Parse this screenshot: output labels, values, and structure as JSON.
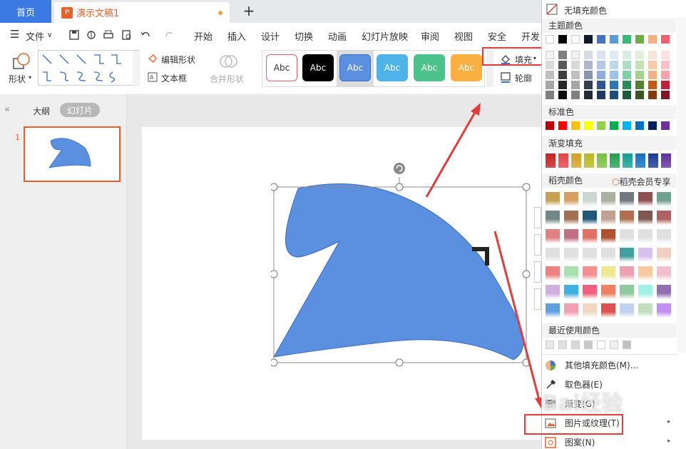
{
  "titlebar": {
    "home": "首页",
    "doc_title": "演示文稿1",
    "new_tab": "+"
  },
  "menubar": {
    "file": "文件",
    "items": [
      "开始",
      "插入",
      "设计",
      "切换",
      "动画",
      "幻灯片放映",
      "审阅",
      "视图",
      "安全",
      "开发"
    ]
  },
  "ribbon": {
    "shapes_label": "形状",
    "edit_shape": "编辑形状",
    "textbox": "文本框",
    "merge_shapes": "合并形状",
    "fill": "填充",
    "outline": "轮廓",
    "style_label": "Abc",
    "styles": [
      {
        "bg": "#ffffff",
        "fg": "#333333",
        "border": "#e06070"
      },
      {
        "bg": "#000000",
        "fg": "#ffffff",
        "border": "#000000"
      },
      {
        "bg": "#5b8fe0",
        "fg": "#ffffff",
        "border": "#3a6cc0"
      },
      {
        "bg": "#4eb3e8",
        "fg": "#ffffff",
        "border": "#4eb3e8"
      },
      {
        "bg": "#4cc38a",
        "fg": "#ffffff",
        "border": "#4cc38a"
      },
      {
        "bg": "#f9b041",
        "fg": "#ffffff",
        "border": "#f9b041"
      }
    ]
  },
  "leftpanel": {
    "outline_tab": "大纲",
    "slides_tab": "幻灯片",
    "slide_number": "1"
  },
  "dropdown": {
    "no_fill": "无填充颜色",
    "theme_colors": "主题颜色",
    "theme_top": [
      "#ffffff",
      "#000000",
      "#ffffff",
      "#0d1a2e",
      "#4472c4",
      "#5b9bd5",
      "#3cb878",
      "#70ad47",
      "#f4b183",
      "#f06070"
    ],
    "theme_cols": [
      [
        "#f2f2f2",
        "#d9d9d9",
        "#bfbfbf",
        "#a6a6a6",
        "#808080"
      ],
      [
        "#7f7f7f",
        "#595959",
        "#3f3f3f",
        "#262626",
        "#0d0d0d"
      ],
      [
        "#f2f2f2",
        "#d9d9d9",
        "#bfbfbf",
        "#a6a6a6",
        "#808080"
      ],
      [
        "#d6dce4",
        "#adb9ca",
        "#8496b0",
        "#333f4f",
        "#222a35"
      ],
      [
        "#dae3f3",
        "#b4c7e7",
        "#8faadc",
        "#2f5597",
        "#1f3864"
      ],
      [
        "#deebf7",
        "#bdd7ee",
        "#9dc3e6",
        "#2e75b6",
        "#1f4e79"
      ],
      [
        "#d5f0e3",
        "#acdfc5",
        "#83cfa8",
        "#2a8a5a",
        "#1c5c3c"
      ],
      [
        "#e2f0d9",
        "#c5e0b4",
        "#a9d18e",
        "#548235",
        "#385723"
      ],
      [
        "#fbe5d6",
        "#f8cbad",
        "#f4b183",
        "#c55a11",
        "#843c0c"
      ],
      [
        "#fde0e4",
        "#fbc1c9",
        "#f8a2ae",
        "#c0203a",
        "#801527"
      ]
    ],
    "standard_colors": "标准色",
    "standard": [
      "#c00000",
      "#ff0000",
      "#ffc000",
      "#ffff00",
      "#92d050",
      "#00b050",
      "#00b0f0",
      "#0070c0",
      "#002060",
      "#7030a0"
    ],
    "gradient_fill": "渐变填充",
    "gradients": [
      "#c82020",
      "#e84040",
      "#d4a020",
      "#b8b820",
      "#78c040",
      "#20a050",
      "#10a090",
      "#1070c0",
      "#183c90",
      "#6030a0"
    ],
    "docer_colors": "稻壳颜色",
    "docer_vip": "稻壳会员专享",
    "docer_grid": [
      [
        "#c8a050",
        "#d8a060",
        "#c8d8d0",
        "#a8b0a0",
        "#707880",
        "#905050",
        "#70a090"
      ],
      [
        "#708888",
        "#a07050",
        "#205878",
        "#c0a090",
        "#b07050",
        "#805850",
        "#b06060"
      ],
      [
        "#e08080",
        "#c07080",
        "#e07060",
        "#b05030",
        "#e0e0e0",
        "#e0e0e0",
        "#e0e0e0"
      ],
      [
        "#e0e0e0",
        "#e0e0e0",
        "#e0e0e0",
        "#e0e0e0",
        "#40a0a0",
        "#d8c0f0",
        "#f0d0c0"
      ],
      [
        "#f08080",
        "#a8e0b0",
        "#f09090",
        "#f0e890",
        "#f0a0b0",
        "#f8c8a0",
        "#f0c0d0"
      ],
      [
        "#d0b0e0",
        "#40b0e0",
        "#f06080",
        "#f08060",
        "#90c8a0",
        "#a0f0e8",
        "#9070b0"
      ],
      [
        "#60a0e0",
        "#f0a0b0",
        "#f0d8c0",
        "#e05050",
        "#c0d0f0",
        "#c0e0c0",
        "#c090f0"
      ]
    ],
    "recent_colors": "最近使用颜色",
    "recent": [
      "#e8e8e8",
      "#e0e0e0",
      "#d8d8d8",
      "#c8c8c8",
      "#ffffff",
      "#f0f0f0",
      "#c0c0c0"
    ],
    "more_colors": "其他填充颜色(M)...",
    "eyedropper": "取色器(E)",
    "gradient_item": "渐变(G)",
    "picture_texture": "图片或纹理(T)",
    "pattern": "图案(N)"
  },
  "watermark": "Bai经验"
}
